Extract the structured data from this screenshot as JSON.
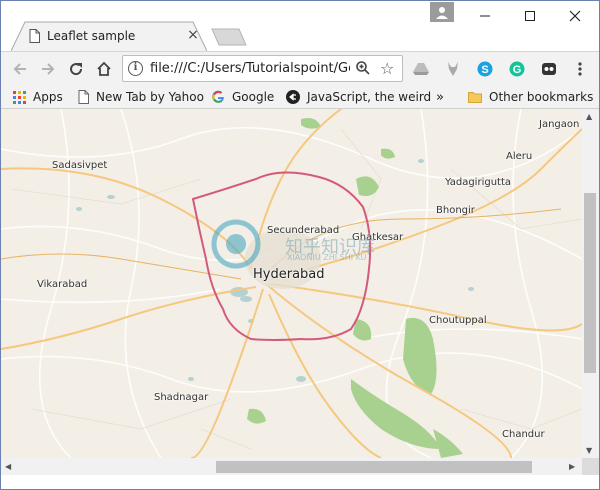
{
  "tab": {
    "title": "Leaflet sample",
    "close": "×"
  },
  "toolbar": {
    "url": "file:///C:/Users/Tutorialspoint/Ge"
  },
  "bookmarks": {
    "items": [
      {
        "label": "Apps",
        "icon": "apps-grid-icon"
      },
      {
        "label": "New Tab by Yahoo",
        "icon": "page-icon"
      },
      {
        "label": "Google",
        "icon": "google-icon"
      },
      {
        "label": "JavaScript, the weird",
        "icon": "js-icon"
      }
    ],
    "overflow": "»",
    "other": "Other bookmarks"
  },
  "map": {
    "labels": {
      "jangaon": "Jangaon",
      "sadasivpet": "Sadasivpet",
      "aleru": "Aleru",
      "yadagirigutta": "Yadagirigutta",
      "bhongir": "Bhongir",
      "secunderabad": "Secunderabad",
      "ghatkesar": "Ghatkesar",
      "hyderabad": "Hyderabad",
      "vikarabad": "Vikarabad",
      "choutuppal": "Choutuppal",
      "shadnagar": "Shadnagar",
      "chandur": "Chandur"
    },
    "watermark": {
      "main": "知乎知识库",
      "sub": "XIAONIU ZHI SHI KU"
    }
  },
  "colors": {
    "accent": "#1a73e8",
    "ring_road": "#d25a7a",
    "water": "#b5d0d0",
    "park": "#a8d18f"
  }
}
